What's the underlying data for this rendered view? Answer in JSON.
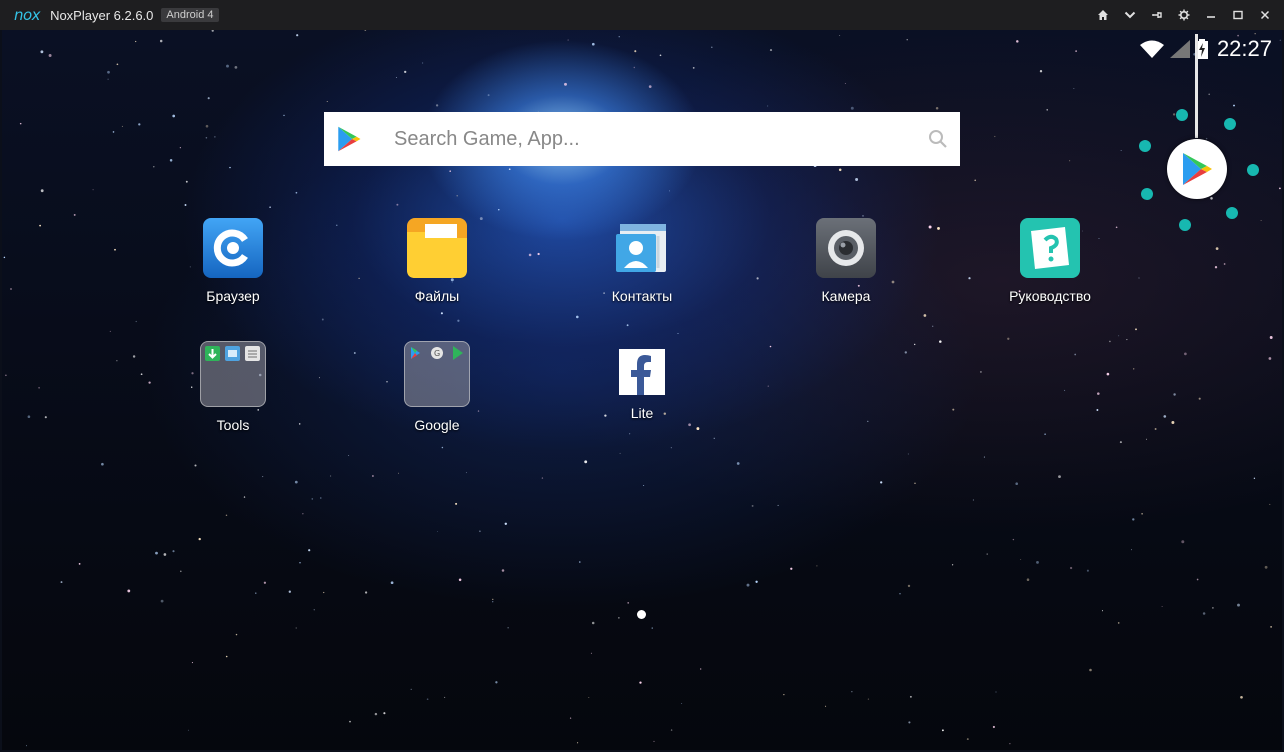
{
  "titlebar": {
    "logo": "nox",
    "title": "NoxPlayer 6.2.6.0",
    "badge": "Android 4",
    "controls": [
      "home-icon",
      "chevron-down-icon",
      "pin-icon",
      "gear-icon",
      "minimize-icon",
      "maximize-icon",
      "close-icon"
    ]
  },
  "status": {
    "clock": "22:27",
    "icons": [
      "wifi-icon",
      "signal-icon",
      "battery-charging-icon"
    ]
  },
  "search": {
    "placeholder": "Search Game, App..."
  },
  "apps": [
    {
      "label": "Браузер",
      "icon": "browser-icon"
    },
    {
      "label": "Файлы",
      "icon": "files-icon"
    },
    {
      "label": "Контакты",
      "icon": "contacts-icon"
    },
    {
      "label": "Камера",
      "icon": "camera-icon"
    },
    {
      "label": "Руководство",
      "icon": "guide-icon"
    },
    {
      "label": "Tools",
      "icon": "tools-folder-icon"
    },
    {
      "label": "Google",
      "icon": "google-folder-icon"
    },
    {
      "label": "Lite",
      "icon": "facebook-lite-icon"
    }
  ],
  "colors": {
    "titlebar_bg": "#1e1e20",
    "accent": "#34c3e6",
    "float_dots": "#17b8b0"
  }
}
